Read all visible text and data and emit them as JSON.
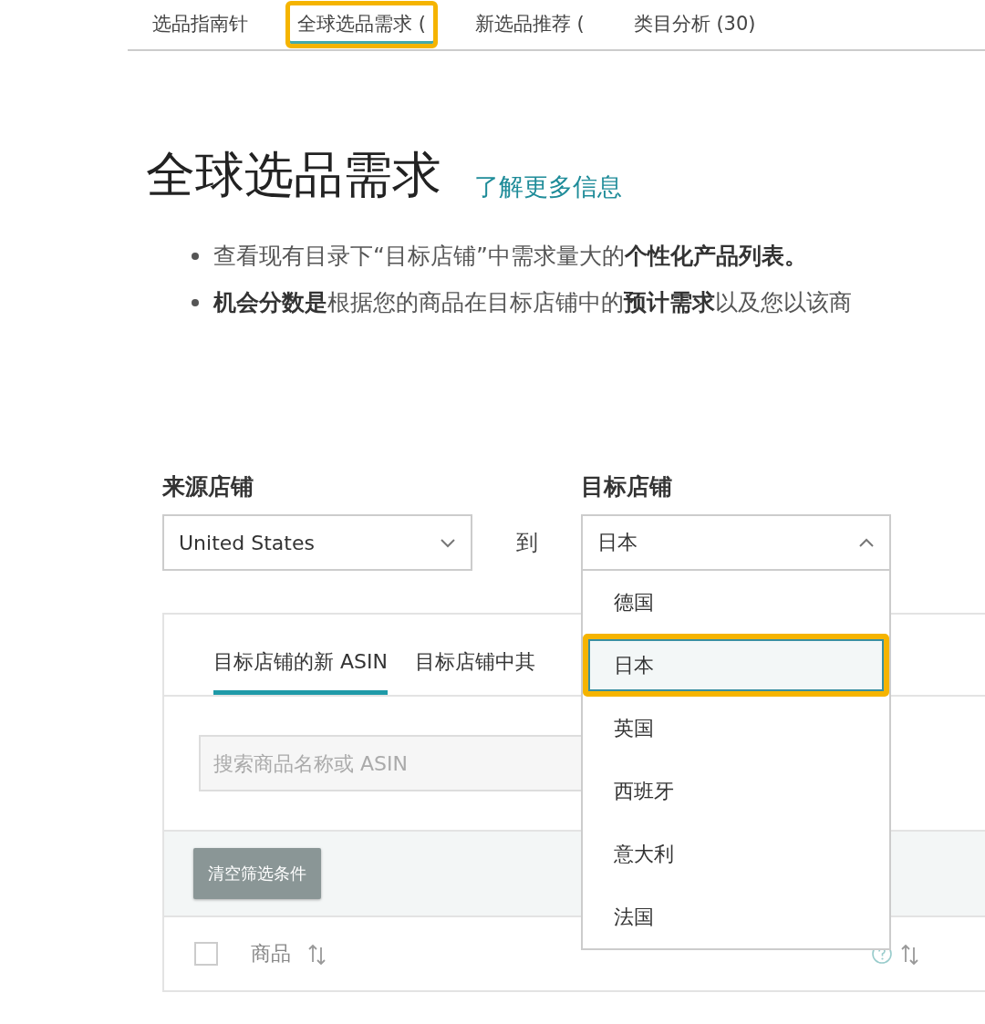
{
  "top_tabs": [
    {
      "label": "选品指南针",
      "selected": false,
      "highlighted": false
    },
    {
      "label": "全球选品需求 (",
      "selected": true,
      "highlighted": true
    },
    {
      "label": "新选品推荐 (",
      "selected": false,
      "highlighted": false
    },
    {
      "label": "类目分析 (30)",
      "selected": false,
      "highlighted": false
    }
  ],
  "heading": "全球选品需求",
  "learn_more_link": "了解更多信息",
  "bullets": [
    "查看现有目录下“目标店铺”中需求量大的**个性化产品列表。**",
    "**机会分数是**根据您的商品在目标店铺中的**预计需求**以及您以该商"
  ],
  "source_store": {
    "label": "来源店铺",
    "value": "United States",
    "expanded": false
  },
  "to_label": "到",
  "target_store": {
    "label": "目标店铺",
    "value": "日本",
    "expanded": true,
    "options": [
      {
        "label": "德国",
        "selected": false,
        "highlighted": false
      },
      {
        "label": "日本",
        "selected": true,
        "highlighted": true
      },
      {
        "label": "英国",
        "selected": false,
        "highlighted": false
      },
      {
        "label": "西班牙",
        "selected": false,
        "highlighted": false
      },
      {
        "label": "意大利",
        "selected": false,
        "highlighted": false
      },
      {
        "label": "法国",
        "selected": false,
        "highlighted": false
      }
    ]
  },
  "panel_tabs": [
    {
      "label": "目标店铺的新 ASIN",
      "selected": true
    },
    {
      "label": "目标店铺中其",
      "selected": false
    }
  ],
  "search": {
    "placeholder": "搜索商品名称或 ASIN"
  },
  "clear_filters_button": "清空筛选条件",
  "table": {
    "select_all_checked": false,
    "columns": [
      {
        "label": "商品"
      }
    ]
  }
}
